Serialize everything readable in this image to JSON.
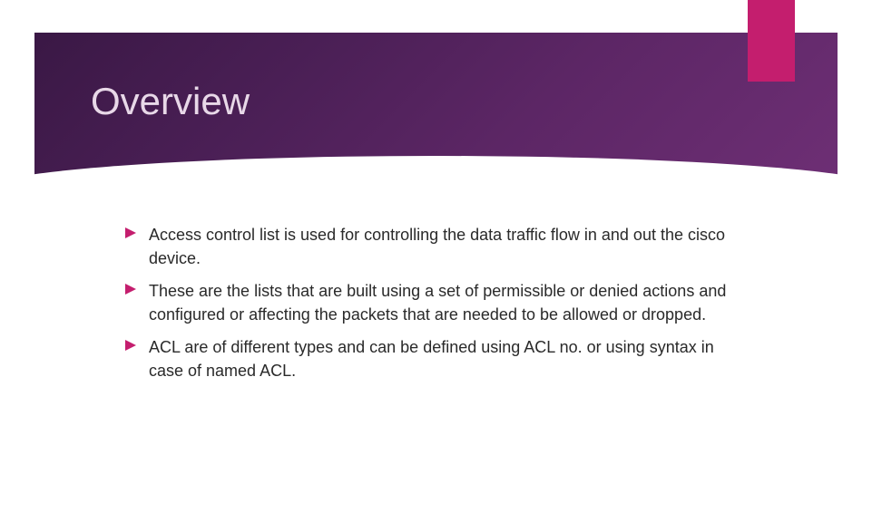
{
  "slide": {
    "title": "Overview",
    "bullets": [
      "Access control list is used for controlling the data traffic flow in and out the cisco device.",
      "These are the lists that are built using a set of permissible or denied actions and configured or affecting the packets that are needed to be allowed or dropped.",
      "ACL are of different types and can be defined using ACL no. or using syntax in case of named ACL."
    ]
  },
  "colors": {
    "accent": "#c41e6e",
    "header_gradient_start": "#3a1845",
    "header_gradient_end": "#6e2f75",
    "title_text": "#e8d8e8",
    "body_text": "#2a2a2a"
  }
}
